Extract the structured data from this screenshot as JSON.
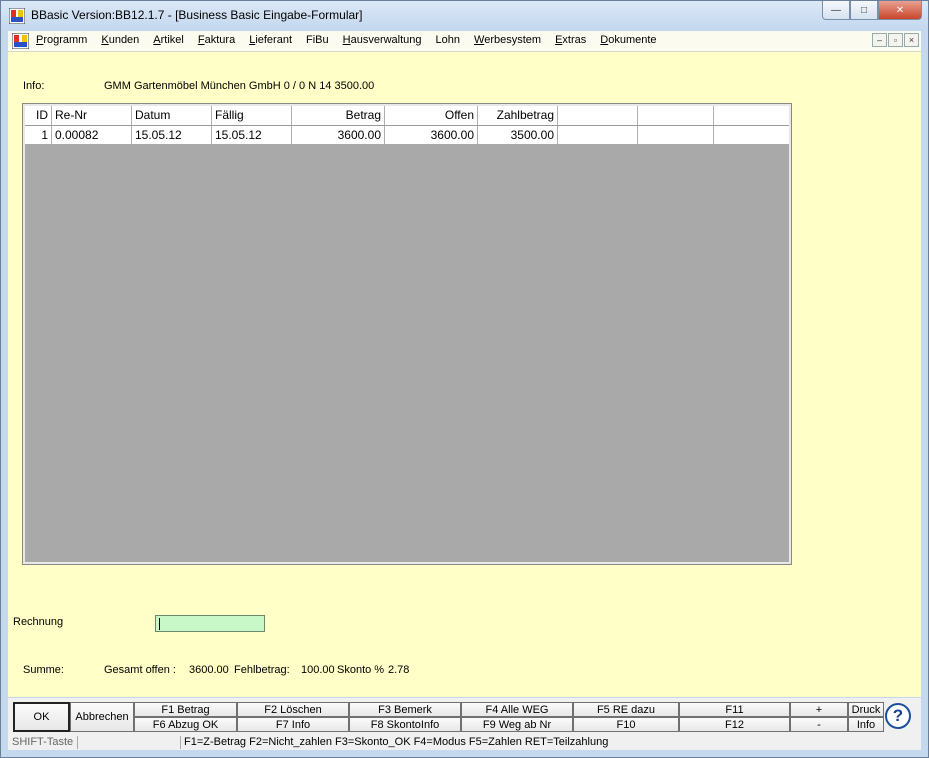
{
  "window": {
    "title": "BBasic Version:BB12.1.7 - [Business Basic Eingabe-Formular]",
    "controls": {
      "minimize": "—",
      "maximize": "□",
      "close": "✕"
    }
  },
  "menu": {
    "items": [
      "Programm",
      "Kunden",
      "Artikel",
      "Faktura",
      "Lieferant",
      "FiBu",
      "Hausverwaltung",
      "Lohn",
      "Werbesystem",
      "Extras",
      "Dokumente"
    ],
    "mdi_controls": {
      "minimize": "–",
      "restore": "▫",
      "close": "×"
    }
  },
  "info": {
    "label": "Info:",
    "text": "GMM Gartenmöbel München GmbH 0 / 0  N 14     3500.00"
  },
  "table": {
    "columns": [
      "ID",
      "Re-Nr",
      "Datum",
      "Fällig",
      "Betrag",
      "Offen",
      "Zahlbetrag",
      "",
      ""
    ],
    "rows": [
      [
        "1",
        "0.00082",
        "15.05.12",
        "15.05.12",
        "3600.00",
        "3600.00",
        "3500.00",
        "",
        ""
      ]
    ]
  },
  "rechnung": {
    "label": "Rechnung",
    "value": ""
  },
  "summary": {
    "label": "Summe:",
    "gesamt_label": "Gesamt offen :",
    "gesamt_value": "3600.00",
    "fehl_label": "Fehlbetrag:",
    "fehl_value": "100.00",
    "skonto_label": "Skonto %",
    "skonto_value": "2.78"
  },
  "buttons": {
    "ok": "OK",
    "abbrechen": "Abbrechen",
    "f1": "F1 Betrag",
    "f2": "F2 Löschen",
    "f3": "F3 Bemerk",
    "f4": "F4 Alle WEG",
    "f5": "F5 RE dazu",
    "f6": "F6 Abzug OK",
    "f7": "F7 Info",
    "f8": "F8 SkontoInfo",
    "f9": "F9 Weg ab Nr",
    "f10": "F10",
    "f11": "F11",
    "f12": "F12",
    "plus": "+",
    "minus": "-",
    "druck": "Druck",
    "info": "Info",
    "help": "?"
  },
  "status": {
    "left": "SHIFT-Taste",
    "hint": "F1=Z-Betrag F2=Nicht_zahlen F3=Skonto_OK F4=Modus F5=Zahlen RET=Teilzahlung"
  },
  "colors": {
    "background": "#ffffc7",
    "input": "#c8f7c8",
    "grid": "#a9a9a9"
  }
}
